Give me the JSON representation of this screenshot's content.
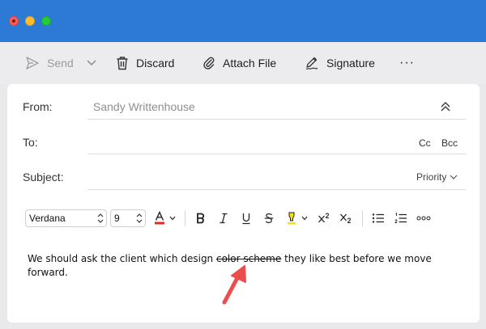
{
  "toolbar": {
    "send_label": "Send",
    "discard_label": "Discard",
    "attach_label": "Attach File",
    "signature_label": "Signature",
    "more_label": "···"
  },
  "compose": {
    "from_label": "From:",
    "from_value": "Sandy Writtenhouse",
    "to_label": "To:",
    "cc_label": "Cc",
    "bcc_label": "Bcc",
    "subject_label": "Subject:",
    "priority_label": "Priority"
  },
  "format": {
    "font": "Verdana",
    "size": "9"
  },
  "body": {
    "before": "We should ask the client which design ",
    "strikethrough": "color scheme",
    "after": " they like best before we move forward."
  },
  "colors": {
    "titlebar": "#2c7ad6",
    "arrow": "#ec4d4d",
    "font_color_bar": "#e02a2a",
    "highlight": "#f5e400"
  }
}
